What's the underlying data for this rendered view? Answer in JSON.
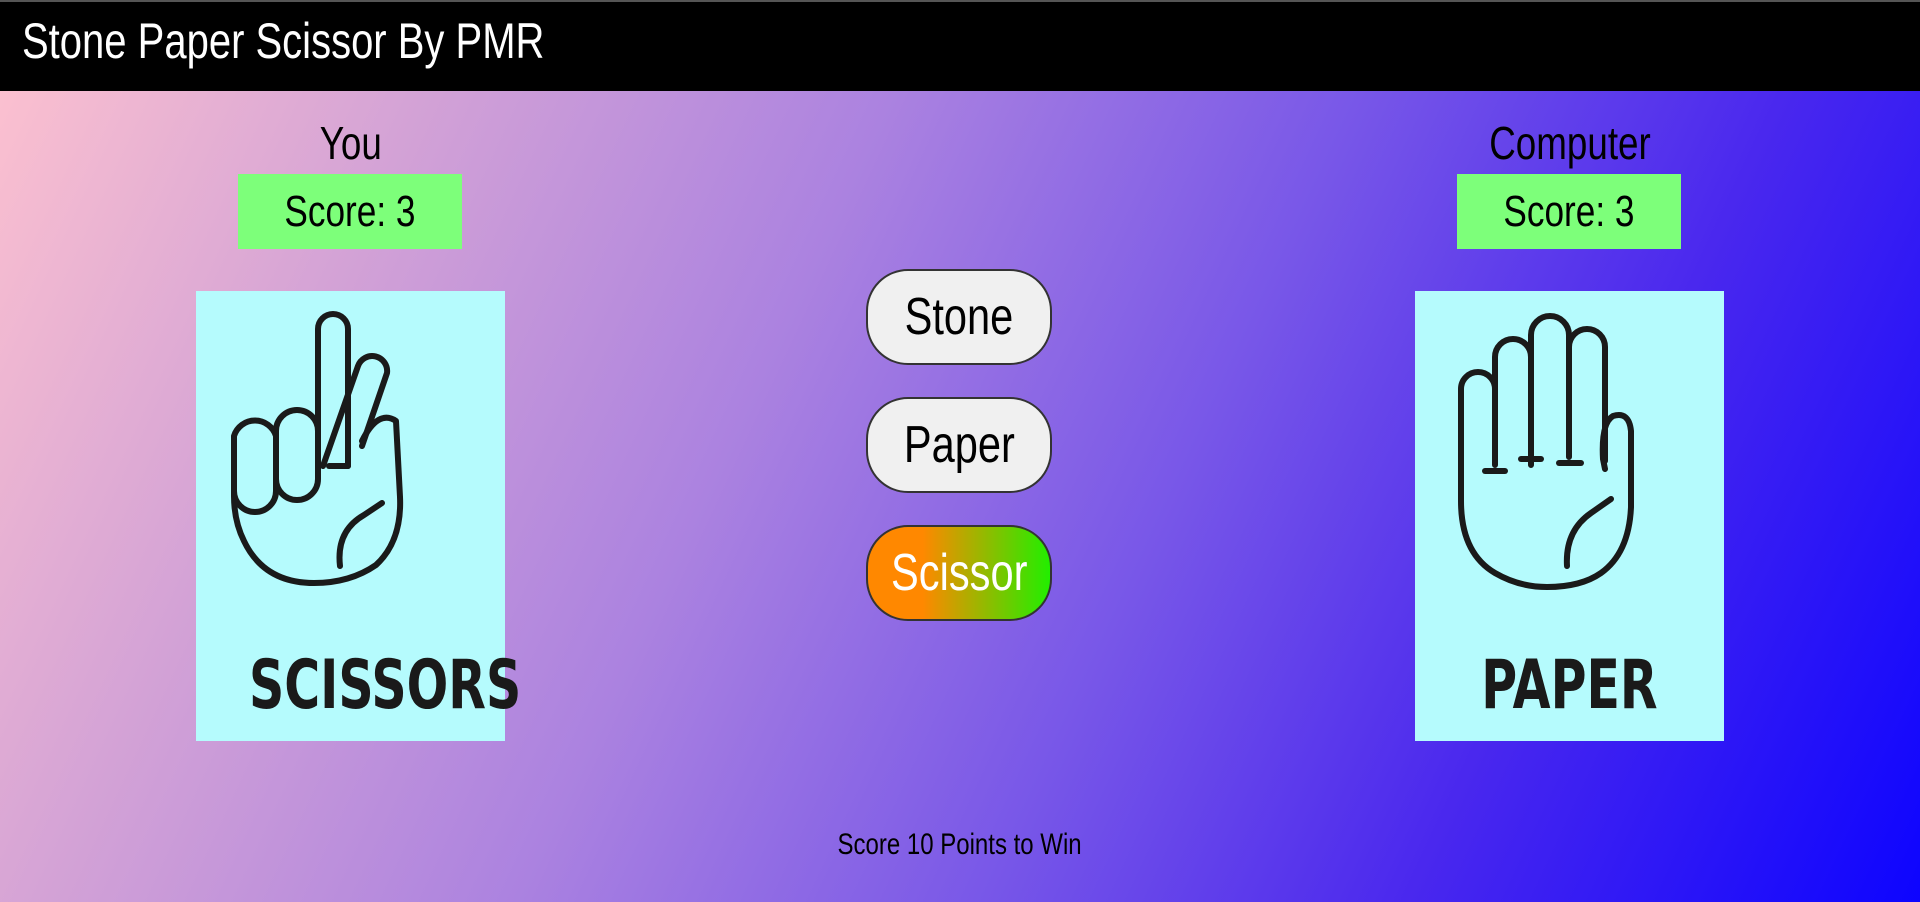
{
  "header": {
    "title": "Stone Paper Scissor By PMR"
  },
  "player": {
    "label": "You",
    "score_text": "Score: 3",
    "choice": {
      "icon": "scissors-hand-icon",
      "caption": "SCISSORS"
    }
  },
  "computer": {
    "label": "Computer",
    "score_text": "Score: 3",
    "choice": {
      "icon": "paper-hand-icon",
      "caption": "PAPER"
    }
  },
  "choices": [
    {
      "label": "Stone",
      "selected": false
    },
    {
      "label": "Paper",
      "selected": false
    },
    {
      "label": "Scissor",
      "selected": true
    }
  ],
  "footer": {
    "goal_text": "Score 10 Points to Win"
  },
  "colors": {
    "header_bg": "#000000",
    "score_bg": "#7dff7a",
    "card_bg": "#b5fbfd",
    "selected_gradient_start": "#ff8800",
    "selected_gradient_end": "#22ee00"
  }
}
